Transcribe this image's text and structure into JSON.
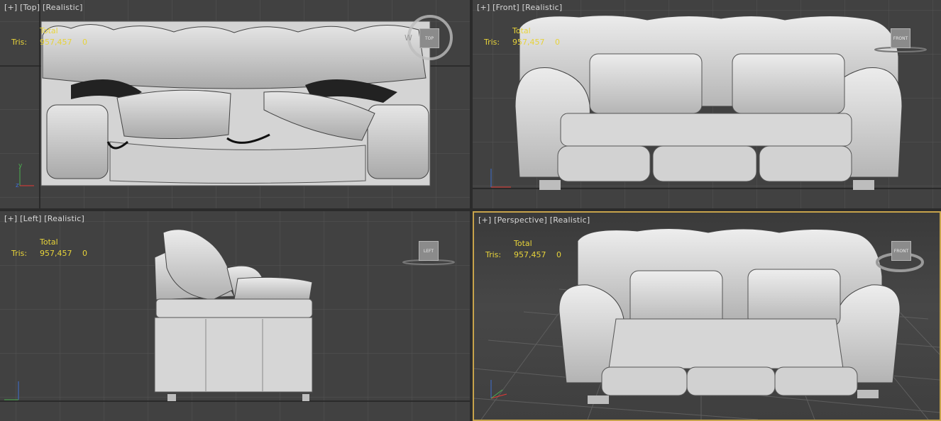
{
  "viewports": {
    "top": {
      "label_plus": "[+]",
      "label_view": "[Top]",
      "label_mode": "[Realistic]",
      "stats_total": "Total",
      "stats_key": "Tris:",
      "stats_value": "957,457",
      "stats_sel": "0",
      "viewcube": "TOP",
      "compass": "W"
    },
    "front": {
      "label_plus": "[+]",
      "label_view": "[Front]",
      "label_mode": "[Realistic]",
      "stats_total": "Total",
      "stats_key": "Tris:",
      "stats_value": "957,457",
      "stats_sel": "0",
      "viewcube": "FRONT"
    },
    "left": {
      "label_plus": "[+]",
      "label_view": "[Left]",
      "label_mode": "[Realistic]",
      "stats_total": "Total",
      "stats_key": "Tris:",
      "stats_value": "957,457",
      "stats_sel": "0",
      "viewcube": "LEFT"
    },
    "perspective": {
      "label_plus": "[+]",
      "label_view": "[Perspective]",
      "label_mode": "[Realistic]",
      "stats_total": "Total",
      "stats_key": "Tris:",
      "stats_value": "957,457",
      "stats_sel": "0",
      "viewcube": "FRONT"
    }
  },
  "colors": {
    "viewport_bg": "#414141",
    "grid_line": "#545454",
    "active_border": "#c7a34b",
    "stats_text": "#e7d33a",
    "model_fill": "#d9d9d9",
    "model_shade": "#9a9a9a"
  },
  "icons": [
    "axis-gizmo-icon",
    "viewcube-icon",
    "compass-ring-icon"
  ]
}
